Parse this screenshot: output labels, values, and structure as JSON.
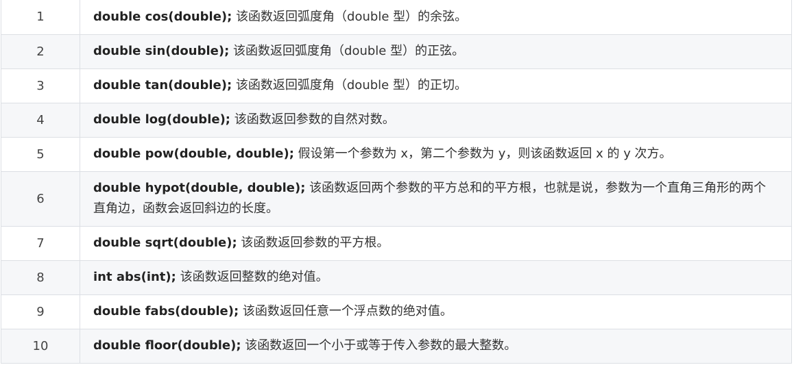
{
  "table": {
    "rows": [
      {
        "num": "1",
        "signature": "double cos(double);",
        "description": "该函数返回弧度角（double 型）的余弦。"
      },
      {
        "num": "2",
        "signature": "double sin(double);",
        "description": "该函数返回弧度角（double 型）的正弦。"
      },
      {
        "num": "3",
        "signature": "double tan(double);",
        "description": "该函数返回弧度角（double 型）的正切。"
      },
      {
        "num": "4",
        "signature": "double log(double);",
        "description": "该函数返回参数的自然对数。"
      },
      {
        "num": "5",
        "signature": "double pow(double, double);",
        "description": "假设第一个参数为 x，第二个参数为 y，则该函数返回 x 的 y 次方。"
      },
      {
        "num": "6",
        "signature": "double hypot(double, double);",
        "description": "该函数返回两个参数的平方总和的平方根，也就是说，参数为一个直角三角形的两个直角边，函数会返回斜边的长度。"
      },
      {
        "num": "7",
        "signature": "double sqrt(double);",
        "description": "该函数返回参数的平方根。"
      },
      {
        "num": "8",
        "signature": "int abs(int);",
        "description": "该函数返回整数的绝对值。"
      },
      {
        "num": "9",
        "signature": "double fabs(double);",
        "description": "该函数返回任意一个浮点数的绝对值。"
      },
      {
        "num": "10",
        "signature": "double floor(double);",
        "description": "该函数返回一个小于或等于传入参数的最大整数。"
      }
    ]
  }
}
